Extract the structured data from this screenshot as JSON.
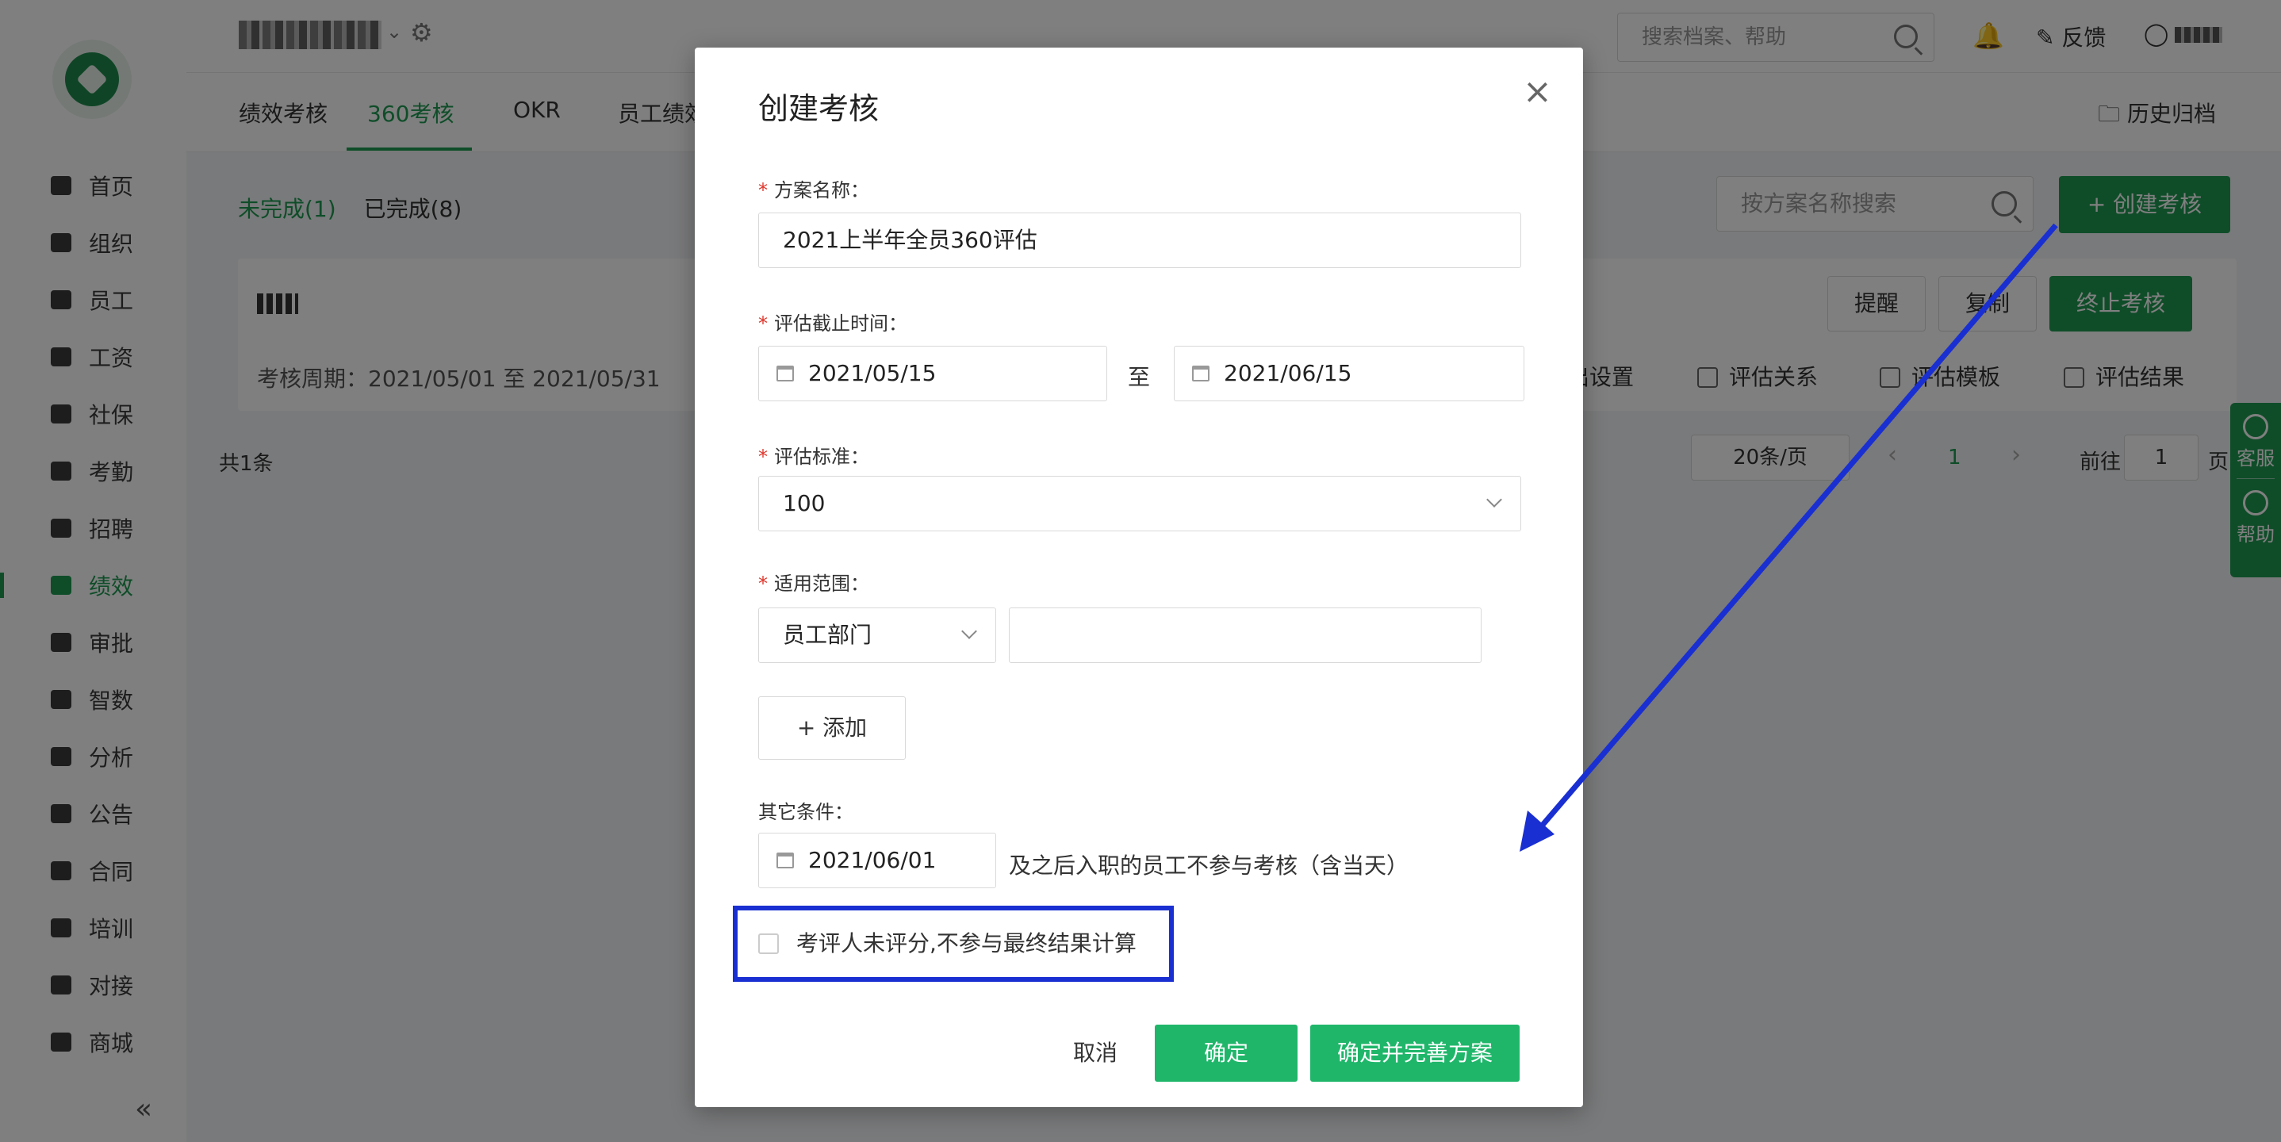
{
  "sidebar": {
    "items": [
      {
        "label": "首页"
      },
      {
        "label": "组织"
      },
      {
        "label": "员工"
      },
      {
        "label": "工资"
      },
      {
        "label": "社保"
      },
      {
        "label": "考勤"
      },
      {
        "label": "招聘"
      },
      {
        "label": "绩效"
      },
      {
        "label": "审批"
      },
      {
        "label": "智数"
      },
      {
        "label": "分析"
      },
      {
        "label": "公告"
      },
      {
        "label": "合同"
      },
      {
        "label": "培训"
      },
      {
        "label": "对接"
      },
      {
        "label": "商城"
      }
    ],
    "active_index": 7,
    "collapse_icon": "«"
  },
  "topbar": {
    "search_placeholder": "搜索档案、帮助",
    "feedback_label": "反馈"
  },
  "tabs": [
    "绩效考核",
    "360考核",
    "OKR",
    "员工绩效"
  ],
  "history_label": "历史归档",
  "filters": {
    "incomplete": "未完成(1)",
    "complete": "已完成(8)"
  },
  "plan_search_placeholder": "按方案名称搜索",
  "create_button": "+ 创建考核",
  "card": {
    "period": "考核周期：2021/05/01 至 2021/05/31",
    "buttons": [
      "提醒",
      "复制",
      "终止考核"
    ],
    "links": [
      "出设置",
      "评估关系",
      "评估模板",
      "评估结果"
    ]
  },
  "pagination": {
    "total": "共1条",
    "page_size": "20条/页",
    "current_page": "1",
    "goto_label": "前往",
    "goto_value": "1",
    "page_suffix": "页"
  },
  "float_help": {
    "service": "客服",
    "help": "帮助"
  },
  "modal": {
    "title": "创建考核",
    "close_icon": "×",
    "plan_name_label": "方案名称：",
    "plan_name_value": "2021上半年全员360评估",
    "deadline_label": "评估截止时间：",
    "date_start": "2021/05/15",
    "range_sep": "至",
    "date_end": "2021/06/15",
    "standard_label": "评估标准：",
    "standard_value": "100",
    "scope_label": "适用范围：",
    "scope_select": "员工部门",
    "scope_value": "",
    "add_button": "+  添加",
    "other_label": "其它条件：",
    "other_date": "2021/06/01",
    "other_text": "及之后入职的员工不参与考核（含当天）",
    "checkbox_label": "考评人未评分,不参与最终结果计算",
    "cancel": "取消",
    "ok": "确定",
    "ok_complete": "确定并完善方案"
  },
  "colors": {
    "brand_green": "#1f9a52",
    "button_green": "#1fb66a",
    "annotation_blue": "#1a2fd1",
    "required_red": "#e0362b"
  }
}
